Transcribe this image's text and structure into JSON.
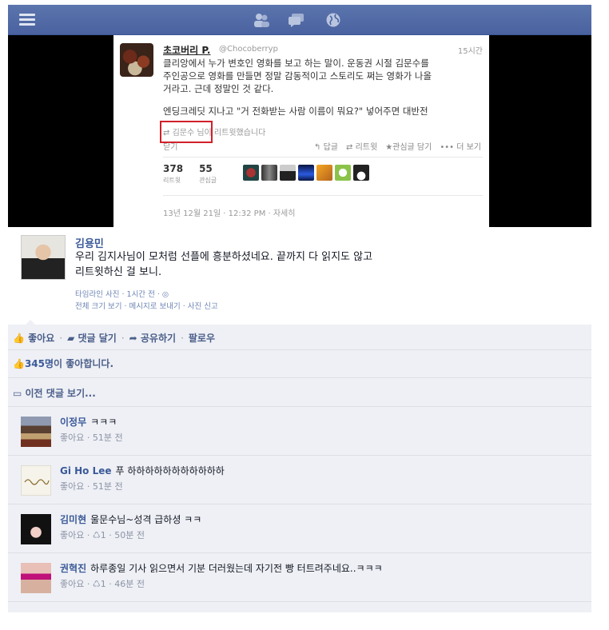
{
  "topbar": {
    "icons": [
      "menu-icon",
      "friends-icon",
      "messages-icon",
      "globe-icon"
    ],
    "bg_color": "#4a62a0"
  },
  "tweet": {
    "author_name": "초코버리 P.",
    "handle": "@Chocoberryp",
    "time": "15시간",
    "body_p1": "클리앙에서 누가 변호인 영화를 보고 하는 말이. 운동권 시절 김문수를\n주인공으로 영화를 만들면 정말 감동적이고 스토리도 쩌는 영화가 나올\n거라고. 근데 정말인 것 같다.",
    "body_p2": "엔딩크레딧 지나고 \"거 전화받는 사람 이름이 뭐요?\" 넣어주면 대반전",
    "retweeted_by": "김문수 님이 리트윗했습니다",
    "more_frag": "닫기",
    "actions": {
      "reply": "답글",
      "retweet": "리트윗",
      "favorite": "관심글 담기",
      "more": "더 보기"
    },
    "stats": {
      "retweets_count": "378",
      "retweets_label": "리트윗",
      "favorites_count": "55",
      "favorites_label": "관심글"
    },
    "date": "13년 12월 21일 · 12:32 PM · 자세히",
    "highlight_color": "#d0202a"
  },
  "post": {
    "author": "김용민",
    "text_line1": "우리 김지사님이 모처럼 선플에 흥분하셨네요. 끝까지 다 읽지도 않고",
    "text_line2": "리트윗하신 걸 보니.",
    "meta1": "타임라인 사진 · 1시간 전 · ◎",
    "meta2": "전체 크기 보기 · 메시지로 보내기 · 사진 신고"
  },
  "feedback": {
    "like_label": "좋아요",
    "comment_label": "댓글 달기",
    "share_label": "공유하기",
    "follow_label": "팔로우",
    "likes_count": "345명",
    "likes_suffix": "이 좋아합니다.",
    "prev_comments": "이전 댓글 보기..."
  },
  "comments": [
    {
      "name": "이정무",
      "text": "ㅋㅋㅋ",
      "meta": "좋아요 · 51분 전"
    },
    {
      "name": "Gi Ho Lee",
      "text": "푸 하하하하하하하하하하하",
      "meta": "좋아요 · 51분 전"
    },
    {
      "name": "김미현",
      "text": "울문수님~성격 급하셩 ㅋㅋ",
      "meta": "좋아요 · ♺1 · 50분 전"
    },
    {
      "name": "권혁진",
      "text": "하루종일 기사 읽으면서 기분 더러웠는데 자기전 빵 터트려주네요..ㅋㅋㅋ",
      "meta": "좋아요 · ♺1 · 46분 전"
    }
  ]
}
